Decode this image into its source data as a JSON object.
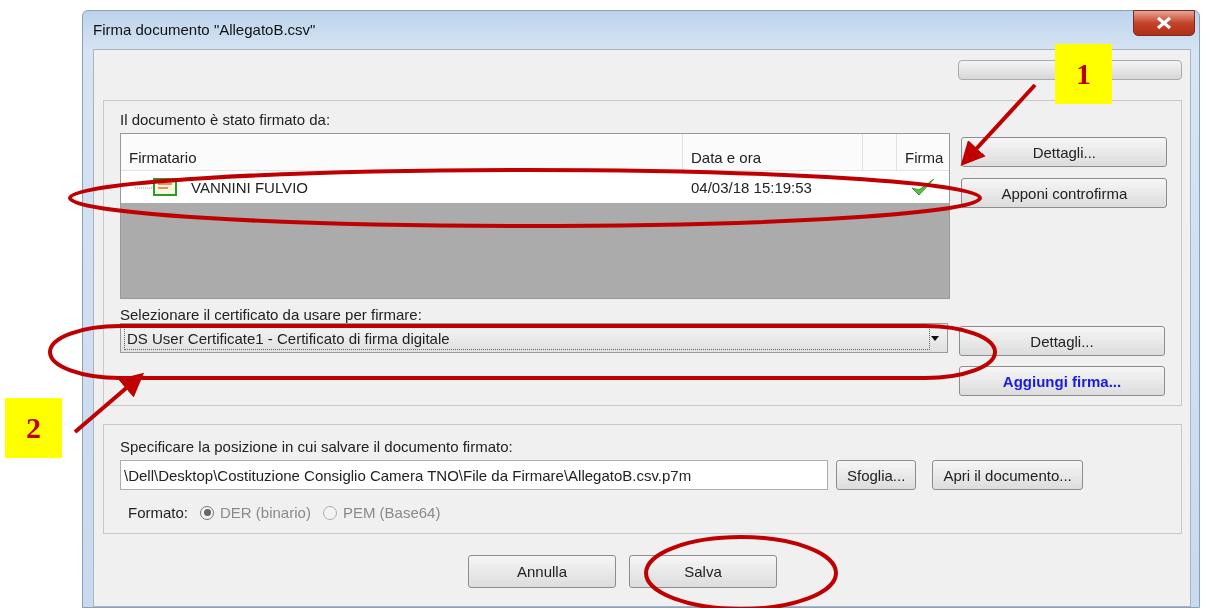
{
  "window": {
    "title": "Firma documento \"AllegatoB.csv\""
  },
  "progress": {
    "level": 0
  },
  "signers": {
    "label": "Il documento è stato firmato da:",
    "columns": [
      {
        "label": "Firmatario"
      },
      {
        "label": "Data e ora"
      },
      {
        "label": "Firma"
      }
    ],
    "rows": [
      {
        "name": "VANNINI FULVIO",
        "date": "04/03/18 15:19:53",
        "signed": true
      }
    ],
    "buttons": [
      {
        "label": "Dettagli...",
        "kind": "normal"
      },
      {
        "label": "Apponi controfirma",
        "kind": "normal"
      }
    ]
  },
  "certificate": {
    "label": "Selezionare il certificato da usare per firmare:",
    "value": "DS User Certificate1 - Certificato di firma digitale",
    "buttons": [
      {
        "label": "Dettagli...",
        "kind": "normal"
      },
      {
        "label": "Aggiungi firma...",
        "kind": "link"
      }
    ]
  },
  "save": {
    "label": "Specificare la posizione in cui salvare il documento firmato:",
    "path": "\\Dell\\Desktop\\Costituzione Consiglio Camera TNO\\File da Firmare\\AllegatoB.csv.p7m",
    "buttons": [
      {
        "label": "Sfoglia...",
        "kind": "normal"
      },
      {
        "label": "Apri il documento...",
        "kind": "normal"
      }
    ],
    "format": {
      "label": "Formato:",
      "options": [
        {
          "label": "DER (binario)",
          "selected": true,
          "disabled": true
        },
        {
          "label": "PEM (Base64)",
          "selected": false,
          "disabled": true
        }
      ]
    }
  },
  "footer": {
    "buttons": [
      {
        "label": "Annulla"
      },
      {
        "label": "Salva"
      }
    ]
  },
  "callouts": [
    {
      "label": "1"
    },
    {
      "label": "2"
    }
  ]
}
